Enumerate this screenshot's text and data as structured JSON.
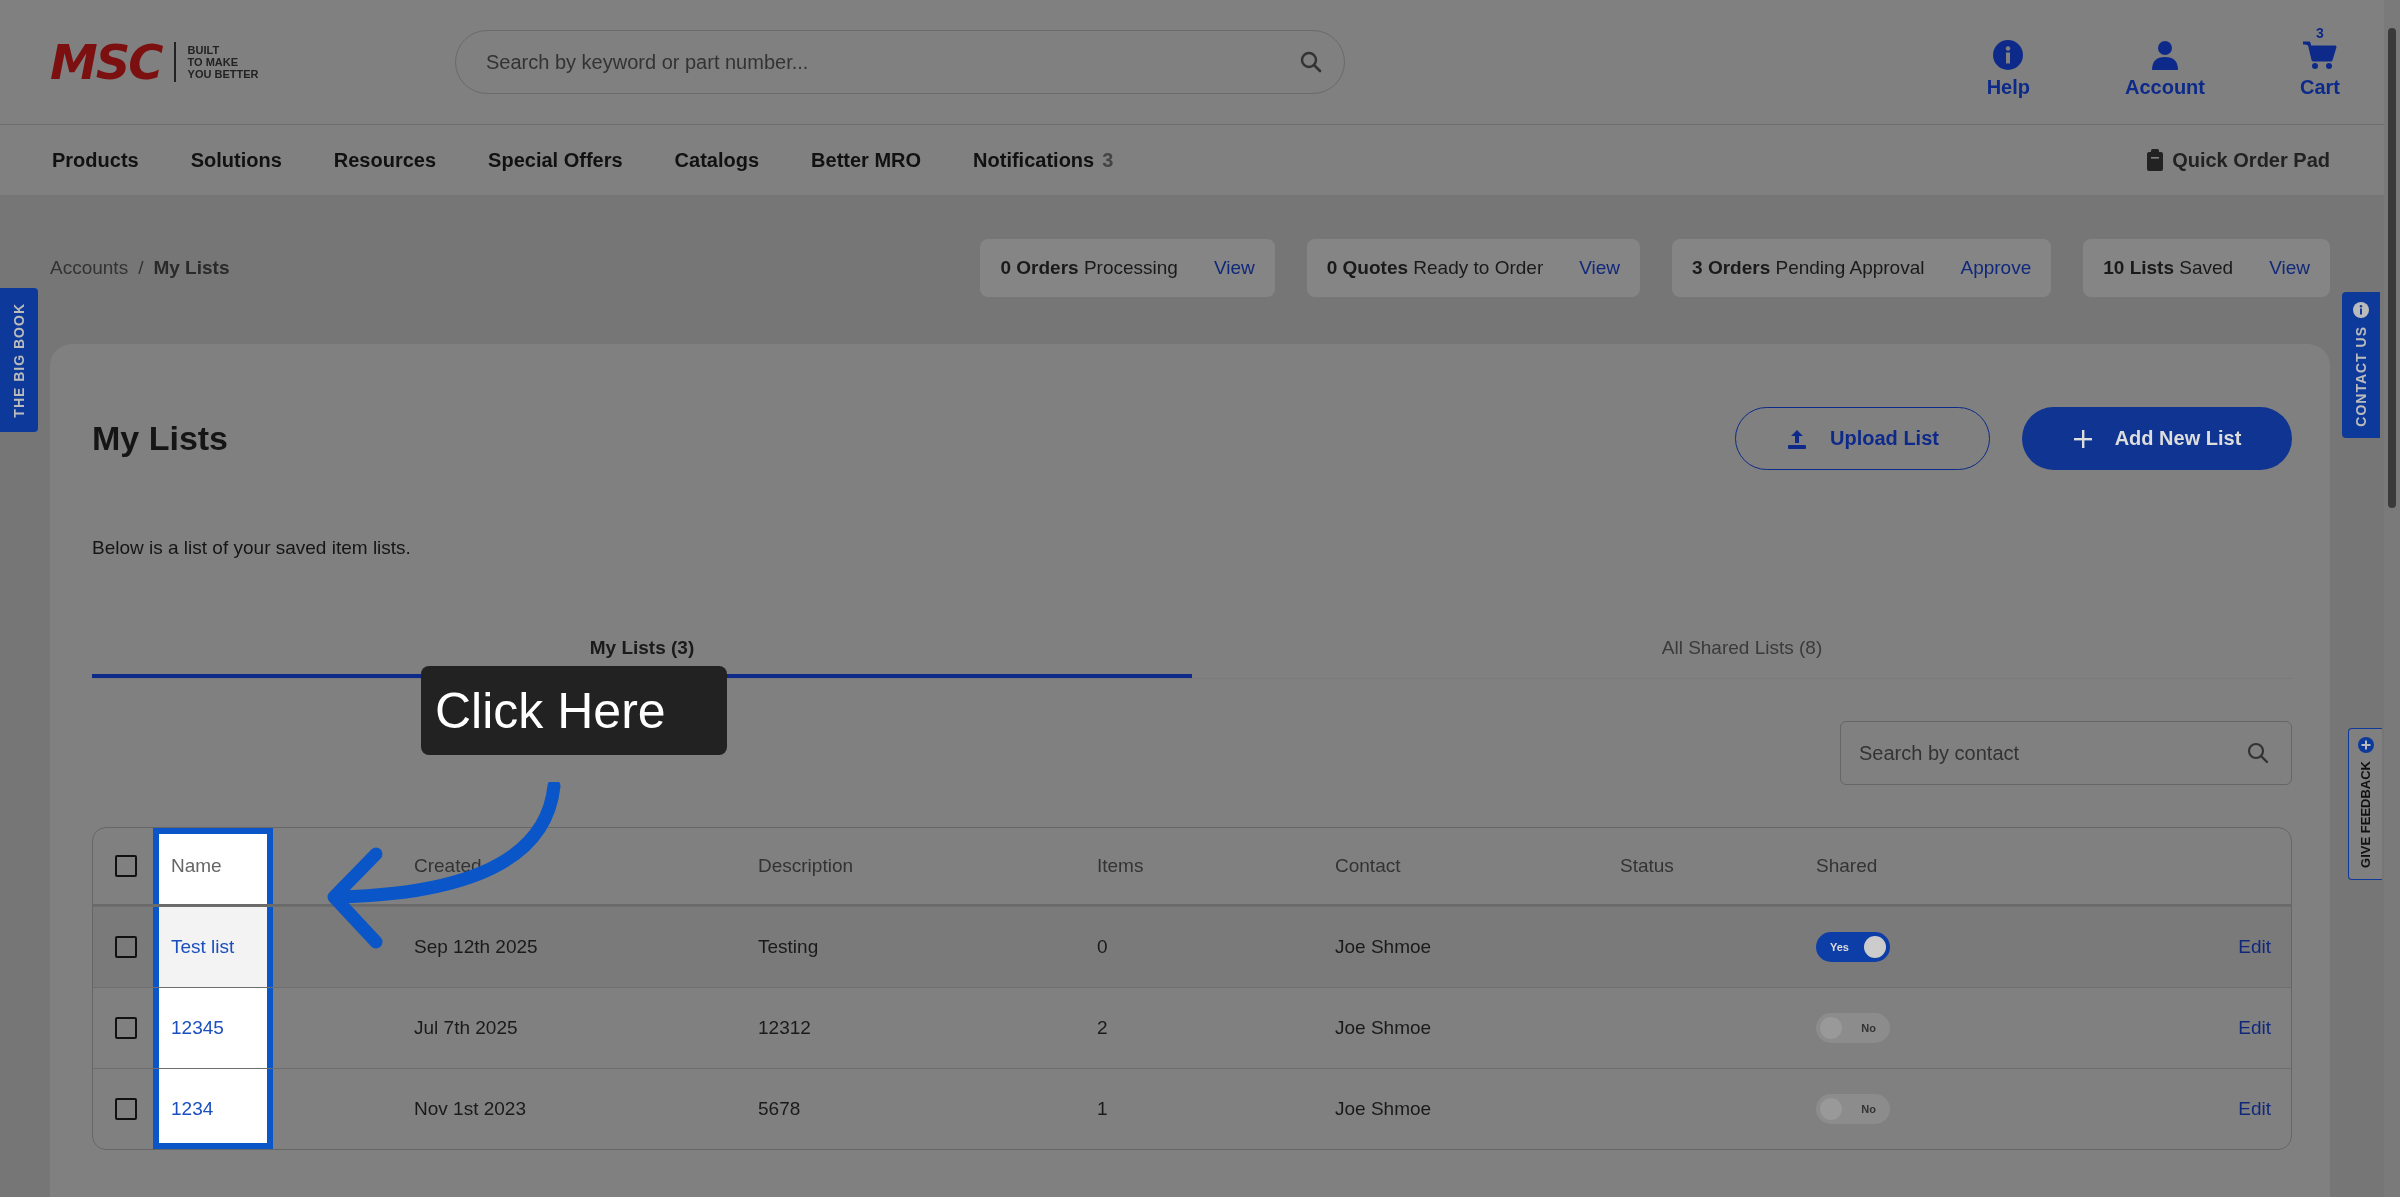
{
  "header": {
    "logo": {
      "wordmark": "MSC",
      "tagline": [
        "BUILT",
        "TO MAKE",
        "YOU BETTER"
      ]
    },
    "search": {
      "placeholder": "Search by keyword or part number..."
    },
    "actions": [
      {
        "kind": "help",
        "label": "Help"
      },
      {
        "kind": "account",
        "label": "Account"
      },
      {
        "kind": "cart",
        "label": "Cart",
        "badge": "3"
      }
    ]
  },
  "nav": {
    "items": [
      {
        "label": "Products"
      },
      {
        "label": "Solutions"
      },
      {
        "label": "Resources"
      },
      {
        "label": "Special Offers"
      },
      {
        "label": "Catalogs"
      },
      {
        "label": "Better MRO"
      },
      {
        "label": "Notifications",
        "count": "3"
      }
    ],
    "quick_order": "Quick Order Pad"
  },
  "breadcrumb": [
    "Accounts",
    "My Lists"
  ],
  "breadcrumb_separator": "/",
  "summary": [
    {
      "text": "**0 Orders** Processing",
      "action": "View"
    },
    {
      "text": "**0 Quotes** Ready to Order",
      "action": "View"
    },
    {
      "text": "**3 Orders** Pending Approval",
      "action": "Approve"
    },
    {
      "text": "**10 Lists** Saved",
      "action": "View"
    }
  ],
  "side_tabs": {
    "left": "THE BIG BOOK",
    "contact": "CONTACT US",
    "feedback": "GIVE FEEDBACK"
  },
  "page": {
    "title": "My Lists",
    "buttons": [
      {
        "kind": "upload",
        "label": "Upload List"
      },
      {
        "kind": "add",
        "label": "Add New List"
      }
    ],
    "description": "Below is a list of your saved item lists.",
    "tabs": [
      {
        "label": "My Lists (3)",
        "selected": true
      },
      {
        "label": "All Shared Lists (8)",
        "selected": false
      }
    ],
    "search": {
      "placeholder": "Search by contact"
    }
  },
  "table": {
    "select_all": {
      "checked": false
    },
    "columns": [
      {
        "label": "Name",
        "highlighted": true
      },
      {
        "label": "Created"
      },
      {
        "label": "Description"
      },
      {
        "label": "Items"
      },
      {
        "label": "Contact"
      },
      {
        "label": "Status"
      },
      {
        "label": "Shared"
      }
    ],
    "rows": [
      {
        "checked": false,
        "hovered": true,
        "name": "Test list",
        "created": "Sep 12th 2025",
        "description": "Testing",
        "items": "0",
        "contact": "Joe Shmoe",
        "shared": true,
        "shared_label": "Yes",
        "action": "Edit"
      },
      {
        "checked": false,
        "hovered": false,
        "name": "12345",
        "created": "Jul 7th 2025",
        "description": "12312",
        "items": "2",
        "contact": "Joe Shmoe",
        "shared": false,
        "shared_label": "No",
        "action": "Edit"
      },
      {
        "checked": false,
        "hovered": false,
        "name": "1234",
        "created": "Nov 1st 2023",
        "description": "5678",
        "items": "1",
        "contact": "Joe Shmoe",
        "shared": false,
        "shared_label": "No",
        "action": "Edit"
      }
    ]
  },
  "callout": {
    "text": "Click Here"
  }
}
